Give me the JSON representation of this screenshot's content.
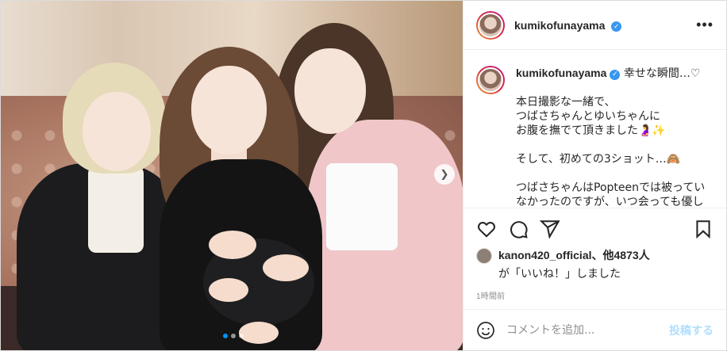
{
  "post": {
    "username": "kumikofunayama",
    "verified_icon": "verified-badge-icon",
    "more_icon": "more-options-icon"
  },
  "caption": {
    "username": "kumikofunayama",
    "text": "幸せな瞬間…♡\n\n本日撮影な一緒で、\nつばさちゃんとゆいちゃんに\nお腹を撫でて頂きました🤰✨\n\nそして、初めての3ショット…🙈\n\nつばさちゃんはPopteenでは被ってい\nなかったのですが、いつ会っても優し"
  },
  "likes": {
    "liker": "kanon420_official",
    "others": "、他4873人",
    "line2": "が「いいね！」しました"
  },
  "time": "1時間前",
  "comment": {
    "placeholder": "コメントを追加...",
    "post_label": "投稿する"
  },
  "carousel": {
    "total": 3,
    "active": 1
  },
  "colors": {
    "accent": "#0095f6",
    "post_button": "#b2dffc",
    "verified": "#3897f0",
    "muted": "#8e8e8e"
  }
}
